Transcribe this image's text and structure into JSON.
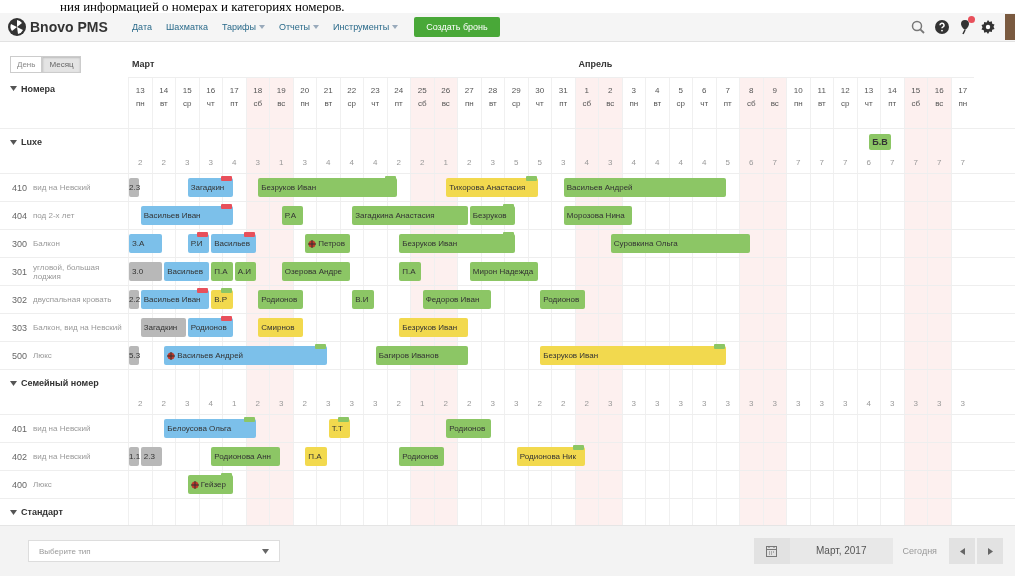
{
  "document_text": "ния информацией о номерах и категориях номеров.",
  "app": {
    "logo": "Bnovo PMS"
  },
  "nav": [
    {
      "label": "Дата",
      "dropdown": false
    },
    {
      "label": "Шахматка",
      "dropdown": false
    },
    {
      "label": "Тарифы",
      "dropdown": true
    },
    {
      "label": "Отчеты",
      "dropdown": true
    },
    {
      "label": "Инструменты",
      "dropdown": true
    }
  ],
  "create_button": "Создать бронь",
  "notifications": {
    "unread": true
  },
  "view_toggle": [
    {
      "label": "День",
      "selected": false
    },
    {
      "label": "Месяц",
      "selected": true
    }
  ],
  "rooms_header": {
    "label": "Номера",
    "expanded": true
  },
  "months": [
    {
      "name": "Март",
      "days": [
        {
          "num": "13",
          "wd": "пн",
          "weekend": false
        },
        {
          "num": "14",
          "wd": "вт",
          "weekend": false
        },
        {
          "num": "15",
          "wd": "ср",
          "weekend": false
        },
        {
          "num": "16",
          "wd": "чт",
          "weekend": false
        },
        {
          "num": "17",
          "wd": "пт",
          "weekend": false
        },
        {
          "num": "18",
          "wd": "сб",
          "weekend": true
        },
        {
          "num": "19",
          "wd": "вс",
          "weekend": true
        },
        {
          "num": "20",
          "wd": "пн",
          "weekend": false
        },
        {
          "num": "21",
          "wd": "вт",
          "weekend": false
        },
        {
          "num": "22",
          "wd": "ср",
          "weekend": false
        },
        {
          "num": "23",
          "wd": "чт",
          "weekend": false
        },
        {
          "num": "24",
          "wd": "пт",
          "weekend": false
        },
        {
          "num": "25",
          "wd": "сб",
          "weekend": true
        },
        {
          "num": "26",
          "wd": "вс",
          "weekend": true
        },
        {
          "num": "27",
          "wd": "пн",
          "weekend": false
        },
        {
          "num": "28",
          "wd": "вт",
          "weekend": false
        },
        {
          "num": "29",
          "wd": "ср",
          "weekend": false
        },
        {
          "num": "30",
          "wd": "чт",
          "weekend": false
        },
        {
          "num": "31",
          "wd": "пт",
          "weekend": false
        }
      ]
    },
    {
      "name": "Апрель",
      "days": [
        {
          "num": "1",
          "wd": "сб",
          "weekend": true
        },
        {
          "num": "2",
          "wd": "вс",
          "weekend": true
        },
        {
          "num": "3",
          "wd": "пн",
          "weekend": false
        },
        {
          "num": "4",
          "wd": "вт",
          "weekend": false
        },
        {
          "num": "5",
          "wd": "ср",
          "weekend": false
        },
        {
          "num": "6",
          "wd": "чт",
          "weekend": false
        },
        {
          "num": "7",
          "wd": "пт",
          "weekend": false
        },
        {
          "num": "8",
          "wd": "сб",
          "weekend": true
        },
        {
          "num": "9",
          "wd": "вс",
          "weekend": true
        },
        {
          "num": "10",
          "wd": "пн",
          "weekend": false
        },
        {
          "num": "11",
          "wd": "вт",
          "weekend": false
        },
        {
          "num": "12",
          "wd": "ср",
          "weekend": false
        },
        {
          "num": "13",
          "wd": "чт",
          "weekend": false
        },
        {
          "num": "14",
          "wd": "пт",
          "weekend": false
        },
        {
          "num": "15",
          "wd": "сб",
          "weekend": true
        },
        {
          "num": "16",
          "wd": "вс",
          "weekend": true
        },
        {
          "num": "17",
          "wd": "пн",
          "weekend": false
        }
      ]
    }
  ],
  "categories": [
    {
      "name": "Luxe",
      "expanded": true,
      "days": [
        {
          "free": "2"
        },
        {
          "free": "2"
        },
        {
          "free": "3"
        },
        {
          "free": "3"
        },
        {
          "free": "4"
        },
        {
          "free": "3"
        },
        {
          "free": "1"
        },
        {
          "free": "3"
        },
        {
          "free": "4"
        },
        {
          "free": "4"
        },
        {
          "free": "4"
        },
        {
          "free": "2"
        },
        {
          "free": "2"
        },
        {
          "free": "1"
        },
        {
          "free": "2"
        },
        {
          "free": "3"
        },
        {
          "free": "5"
        },
        {
          "free": "5"
        },
        {
          "free": "3"
        },
        {
          "free": "4"
        },
        {
          "free": "3"
        },
        {
          "free": "4"
        },
        {
          "free": "4"
        },
        {
          "free": "4"
        },
        {
          "free": "4"
        },
        {
          "free": "5"
        },
        {
          "free": "6"
        },
        {
          "free": "7"
        },
        {
          "free": "7"
        },
        {
          "free": "7"
        },
        {
          "free": "7"
        },
        {
          "free": "6",
          "booking": {
            "guest": "Б.В",
            "color": "#8cc665"
          }
        },
        {
          "free": "7"
        },
        {
          "free": "7"
        },
        {
          "free": "7"
        },
        {
          "free": "7"
        }
      ],
      "rooms": [
        {
          "number": "410",
          "description": "вид на Невский",
          "before": {
            "guest": "2.3",
            "color": "#b8b8b8"
          },
          "nights": [
            {
              "kind": "free"
            },
            {
              "kind": "free"
            },
            {
              "kind": "start",
              "guest": "Загадкин",
              "color": "#7cc0ea",
              "flag": {
                "color": "#e8505b"
              }
            },
            {
              "kind": "stay"
            },
            {
              "kind": "free"
            },
            {
              "kind": "start",
              "guest": "Безруков Иван",
              "color": "#8cc665",
              "flag": {
                "color": "#8cc665"
              }
            },
            {
              "kind": "stay"
            },
            {
              "kind": "stay"
            },
            {
              "kind": "stay"
            },
            {
              "kind": "stay"
            },
            {
              "kind": "stay"
            },
            {
              "kind": "free"
            },
            {
              "kind": "free"
            },
            {
              "kind": "start",
              "guest": "Тихорова Анастасия",
              "color": "#f2d94e",
              "flag": {
                "color": "#8cc665"
              }
            },
            {
              "kind": "stay"
            },
            {
              "kind": "stay"
            },
            {
              "kind": "stay"
            },
            {
              "kind": "free"
            },
            {
              "kind": "start",
              "guest": "Васильев Андрей",
              "color": "#8cc665"
            },
            {
              "kind": "stay"
            },
            {
              "kind": "stay"
            },
            {
              "kind": "stay"
            },
            {
              "kind": "stay"
            },
            {
              "kind": "stay"
            },
            {
              "kind": "stay"
            },
            {
              "kind": "free"
            },
            {
              "kind": "free"
            },
            {
              "kind": "free"
            },
            {
              "kind": "free"
            },
            {
              "kind": "free"
            },
            {
              "kind": "free"
            },
            {
              "kind": "free"
            },
            {
              "kind": "free"
            },
            {
              "kind": "free"
            },
            {
              "kind": "free"
            },
            {
              "kind": "free"
            }
          ]
        },
        {
          "number": "404",
          "description": "под 2-х лет",
          "nights": [
            {
              "kind": "start",
              "guest": "Васильев Иван",
              "color": "#7cc0ea",
              "flag": {
                "color": "#e8505b"
              }
            },
            {
              "kind": "stay"
            },
            {
              "kind": "stay"
            },
            {
              "kind": "stay"
            },
            {
              "kind": "free"
            },
            {
              "kind": "free"
            },
            {
              "kind": "start",
              "guest": "Р.А",
              "color": "#8cc665"
            },
            {
              "kind": "free"
            },
            {
              "kind": "free"
            },
            {
              "kind": "start",
              "guest": "Загадкина Анастасия",
              "color": "#8cc665"
            },
            {
              "kind": "stay"
            },
            {
              "kind": "stay"
            },
            {
              "kind": "stay"
            },
            {
              "kind": "stay"
            },
            {
              "kind": "start",
              "guest": "Безруков",
              "color": "#8cc665",
              "flag": {
                "color": "#8cc665"
              }
            },
            {
              "kind": "stay"
            },
            {
              "kind": "free"
            },
            {
              "kind": "free"
            },
            {
              "kind": "start",
              "guest": "Морозова Нина",
              "color": "#8cc665"
            },
            {
              "kind": "stay"
            },
            {
              "kind": "stay"
            },
            {
              "kind": "free"
            },
            {
              "kind": "free"
            },
            {
              "kind": "free"
            },
            {
              "kind": "free"
            },
            {
              "kind": "free"
            },
            {
              "kind": "free"
            },
            {
              "kind": "free"
            },
            {
              "kind": "free"
            },
            {
              "kind": "free"
            },
            {
              "kind": "free"
            },
            {
              "kind": "free"
            },
            {
              "kind": "free"
            },
            {
              "kind": "free"
            },
            {
              "kind": "free"
            },
            {
              "kind": "free"
            }
          ]
        },
        {
          "number": "300",
          "description": "Балкон",
          "before": {
            "guest": "З.А",
            "color": "#7cc0ea"
          },
          "nights": [
            {
              "kind": "stay"
            },
            {
              "kind": "free"
            },
            {
              "kind": "start",
              "guest": "Р.И",
              "color": "#7cc0ea",
              "flag": {
                "color": "#e8505b"
              }
            },
            {
              "kind": "start",
              "guest": "Васильев",
              "color": "#7cc0ea",
              "flag": {
                "color": "#e8505b"
              }
            },
            {
              "kind": "stay"
            },
            {
              "kind": "free"
            },
            {
              "kind": "free"
            },
            {
              "kind": "start",
              "guest": "Петров",
              "color": "#8cc665",
              "marker": true
            },
            {
              "kind": "stay"
            },
            {
              "kind": "free"
            },
            {
              "kind": "free"
            },
            {
              "kind": "start",
              "guest": "Безруков Иван",
              "color": "#8cc665",
              "flag": {
                "color": "#8cc665"
              }
            },
            {
              "kind": "stay"
            },
            {
              "kind": "stay"
            },
            {
              "kind": "stay"
            },
            {
              "kind": "stay"
            },
            {
              "kind": "free"
            },
            {
              "kind": "free"
            },
            {
              "kind": "free"
            },
            {
              "kind": "free"
            },
            {
              "kind": "start",
              "guest": "Суровкина Ольга",
              "color": "#8cc665"
            },
            {
              "kind": "stay"
            },
            {
              "kind": "stay"
            },
            {
              "kind": "stay"
            },
            {
              "kind": "stay"
            },
            {
              "kind": "stay"
            },
            {
              "kind": "free"
            },
            {
              "kind": "free"
            },
            {
              "kind": "free"
            },
            {
              "kind": "free"
            },
            {
              "kind": "free"
            },
            {
              "kind": "free"
            },
            {
              "kind": "free"
            },
            {
              "kind": "free"
            },
            {
              "kind": "free"
            },
            {
              "kind": "free"
            }
          ]
        },
        {
          "number": "301",
          "description": "угловой, большая лоджия",
          "before": {
            "guest": "3.0",
            "color": "#b8b8b8"
          },
          "nights": [
            {
              "kind": "stay"
            },
            {
              "kind": "start",
              "guest": "Васильев",
              "color": "#7cc0ea"
            },
            {
              "kind": "stay"
            },
            {
              "kind": "start",
              "guest": "П.А",
              "color": "#8cc665"
            },
            {
              "kind": "start",
              "guest": "А.И",
              "color": "#8cc665"
            },
            {
              "kind": "free"
            },
            {
              "kind": "start",
              "guest": "Озерова Андре",
              "color": "#8cc665"
            },
            {
              "kind": "stay"
            },
            {
              "kind": "stay"
            },
            {
              "kind": "free"
            },
            {
              "kind": "free"
            },
            {
              "kind": "start",
              "guest": "П.А",
              "color": "#8cc665"
            },
            {
              "kind": "free"
            },
            {
              "kind": "free"
            },
            {
              "kind": "start",
              "guest": "Мирон Надежда",
              "color": "#8cc665"
            },
            {
              "kind": "stay"
            },
            {
              "kind": "stay"
            },
            {
              "kind": "free"
            },
            {
              "kind": "free"
            },
            {
              "kind": "free"
            },
            {
              "kind": "free"
            },
            {
              "kind": "free"
            },
            {
              "kind": "free"
            },
            {
              "kind": "free"
            },
            {
              "kind": "free"
            },
            {
              "kind": "free"
            },
            {
              "kind": "free"
            },
            {
              "kind": "free"
            },
            {
              "kind": "free"
            },
            {
              "kind": "free"
            },
            {
              "kind": "free"
            },
            {
              "kind": "free"
            },
            {
              "kind": "free"
            },
            {
              "kind": "free"
            },
            {
              "kind": "free"
            },
            {
              "kind": "free"
            }
          ]
        },
        {
          "number": "302",
          "description": "двуспальная кровать",
          "before": {
            "guest": "2.2",
            "color": "#b8b8b8"
          },
          "nights": [
            {
              "kind": "start",
              "guest": "Васильев Иван",
              "color": "#7cc0ea",
              "flag": {
                "color": "#e8505b"
              }
            },
            {
              "kind": "stay"
            },
            {
              "kind": "stay"
            },
            {
              "kind": "start",
              "guest": "В.Р",
              "color": "#f2d94e",
              "flag": {
                "color": "#8cc665"
              }
            },
            {
              "kind": "free"
            },
            {
              "kind": "start",
              "guest": "Родионов",
              "color": "#8cc665"
            },
            {
              "kind": "stay"
            },
            {
              "kind": "free"
            },
            {
              "kind": "free"
            },
            {
              "kind": "start",
              "guest": "В.И",
              "color": "#8cc665"
            },
            {
              "kind": "free"
            },
            {
              "kind": "free"
            },
            {
              "kind": "start",
              "guest": "Федоров Иван",
              "color": "#8cc665"
            },
            {
              "kind": "stay"
            },
            {
              "kind": "stay"
            },
            {
              "kind": "free"
            },
            {
              "kind": "free"
            },
            {
              "kind": "start",
              "guest": "Родионов",
              "color": "#8cc665"
            },
            {
              "kind": "stay"
            },
            {
              "kind": "free"
            },
            {
              "kind": "free"
            },
            {
              "kind": "free"
            },
            {
              "kind": "free"
            },
            {
              "kind": "free"
            },
            {
              "kind": "free"
            },
            {
              "kind": "free"
            },
            {
              "kind": "free"
            },
            {
              "kind": "free"
            },
            {
              "kind": "free"
            },
            {
              "kind": "free"
            },
            {
              "kind": "free"
            },
            {
              "kind": "free"
            },
            {
              "kind": "free"
            },
            {
              "kind": "free"
            },
            {
              "kind": "free"
            },
            {
              "kind": "free"
            }
          ]
        },
        {
          "number": "303",
          "description": "Балкон, вид на Невский",
          "nights": [
            {
              "kind": "start",
              "guest": "Загадкин",
              "color": "#b8b8b8"
            },
            {
              "kind": "stay"
            },
            {
              "kind": "start",
              "guest": "Родионов",
              "color": "#7cc0ea",
              "flag": {
                "color": "#e8505b"
              }
            },
            {
              "kind": "stay"
            },
            {
              "kind": "free"
            },
            {
              "kind": "start",
              "guest": "Смирнов",
              "color": "#f2d94e"
            },
            {
              "kind": "stay"
            },
            {
              "kind": "free"
            },
            {
              "kind": "free"
            },
            {
              "kind": "free"
            },
            {
              "kind": "free"
            },
            {
              "kind": "start",
              "guest": "Безруков Иван",
              "color": "#f2d94e"
            },
            {
              "kind": "stay"
            },
            {
              "kind": "stay"
            },
            {
              "kind": "free"
            },
            {
              "kind": "free"
            },
            {
              "kind": "free"
            },
            {
              "kind": "free"
            },
            {
              "kind": "free"
            },
            {
              "kind": "free"
            },
            {
              "kind": "free"
            },
            {
              "kind": "free"
            },
            {
              "kind": "free"
            },
            {
              "kind": "free"
            },
            {
              "kind": "free"
            },
            {
              "kind": "free"
            },
            {
              "kind": "free"
            },
            {
              "kind": "free"
            },
            {
              "kind": "free"
            },
            {
              "kind": "free"
            },
            {
              "kind": "free"
            },
            {
              "kind": "free"
            },
            {
              "kind": "free"
            },
            {
              "kind": "free"
            },
            {
              "kind": "free"
            },
            {
              "kind": "free"
            }
          ]
        },
        {
          "number": "500",
          "description": "Люкс",
          "before": {
            "guest": "5.3",
            "color": "#b8b8b8"
          },
          "nights": [
            {
              "kind": "free"
            },
            {
              "kind": "start",
              "guest": "Васильев Андрей",
              "color": "#7cc0ea",
              "flag": {
                "color": "#8cc665"
              },
              "marker": true
            },
            {
              "kind": "stay"
            },
            {
              "kind": "stay"
            },
            {
              "kind": "stay"
            },
            {
              "kind": "stay"
            },
            {
              "kind": "stay"
            },
            {
              "kind": "stay"
            },
            {
              "kind": "free"
            },
            {
              "kind": "free"
            },
            {
              "kind": "start",
              "guest": "Багиров Иванов",
              "color": "#8cc665"
            },
            {
              "kind": "stay"
            },
            {
              "kind": "stay"
            },
            {
              "kind": "stay"
            },
            {
              "kind": "free"
            },
            {
              "kind": "free"
            },
            {
              "kind": "free"
            },
            {
              "kind": "start",
              "guest": "Безруков Иван",
              "color": "#f2d94e",
              "flag": {
                "color": "#8cc665"
              }
            },
            {
              "kind": "stay"
            },
            {
              "kind": "stay"
            },
            {
              "kind": "stay"
            },
            {
              "kind": "stay"
            },
            {
              "kind": "stay"
            },
            {
              "kind": "stay"
            },
            {
              "kind": "stay"
            },
            {
              "kind": "free"
            },
            {
              "kind": "free"
            },
            {
              "kind": "free"
            },
            {
              "kind": "free"
            },
            {
              "kind": "free"
            },
            {
              "kind": "free"
            },
            {
              "kind": "free"
            },
            {
              "kind": "free"
            },
            {
              "kind": "free"
            },
            {
              "kind": "free"
            },
            {
              "kind": "free"
            }
          ]
        }
      ]
    },
    {
      "name": "Семейный номер",
      "expanded": true,
      "days": [
        {
          "free": "2"
        },
        {
          "free": "2"
        },
        {
          "free": "3"
        },
        {
          "free": "4"
        },
        {
          "free": "1"
        },
        {
          "free": "2"
        },
        {
          "free": "3"
        },
        {
          "free": "2"
        },
        {
          "free": "3"
        },
        {
          "free": "3"
        },
        {
          "free": "3"
        },
        {
          "free": "2"
        },
        {
          "free": "1"
        },
        {
          "free": "2"
        },
        {
          "free": "2"
        },
        {
          "free": "3"
        },
        {
          "free": "3"
        },
        {
          "free": "2"
        },
        {
          "free": "2"
        },
        {
          "free": "2"
        },
        {
          "free": "3"
        },
        {
          "free": "3"
        },
        {
          "free": "3"
        },
        {
          "free": "3"
        },
        {
          "free": "3"
        },
        {
          "free": "3"
        },
        {
          "free": "3"
        },
        {
          "free": "3"
        },
        {
          "free": "3"
        },
        {
          "free": "3"
        },
        {
          "free": "3"
        },
        {
          "free": "4"
        },
        {
          "free": "3"
        },
        {
          "free": "3"
        },
        {
          "free": "3"
        },
        {
          "free": "3"
        }
      ],
      "rooms": [
        {
          "number": "401",
          "description": "вид на Невский",
          "nights": [
            {
              "kind": "free"
            },
            {
              "kind": "start",
              "guest": "Белоусова Ольга",
              "color": "#7cc0ea",
              "flag": {
                "color": "#8cc665"
              }
            },
            {
              "kind": "stay"
            },
            {
              "kind": "stay"
            },
            {
              "kind": "stay"
            },
            {
              "kind": "free"
            },
            {
              "kind": "free"
            },
            {
              "kind": "free"
            },
            {
              "kind": "start",
              "guest": "Т.Т",
              "color": "#f2d94e",
              "flag": {
                "color": "#8cc665"
              }
            },
            {
              "kind": "free"
            },
            {
              "kind": "free"
            },
            {
              "kind": "free"
            },
            {
              "kind": "free"
            },
            {
              "kind": "start",
              "guest": "Родионов",
              "color": "#8cc665"
            },
            {
              "kind": "stay"
            },
            {
              "kind": "free"
            },
            {
              "kind": "free"
            },
            {
              "kind": "free"
            },
            {
              "kind": "free"
            },
            {
              "kind": "free"
            },
            {
              "kind": "free"
            },
            {
              "kind": "free"
            },
            {
              "kind": "free"
            },
            {
              "kind": "free"
            },
            {
              "kind": "free"
            },
            {
              "kind": "free"
            },
            {
              "kind": "free"
            },
            {
              "kind": "free"
            },
            {
              "kind": "free"
            },
            {
              "kind": "free"
            },
            {
              "kind": "free"
            },
            {
              "kind": "free"
            },
            {
              "kind": "free"
            },
            {
              "kind": "free"
            },
            {
              "kind": "free"
            },
            {
              "kind": "free"
            }
          ]
        },
        {
          "number": "402",
          "description": "вид на Невский",
          "before": {
            "guest": "1.1",
            "color": "#b8b8b8"
          },
          "nights": [
            {
              "kind": "start",
              "guest": "2.3",
              "color": "#b8b8b8"
            },
            {
              "kind": "free"
            },
            {
              "kind": "free"
            },
            {
              "kind": "start",
              "guest": "Родионова Анн",
              "color": "#8cc665"
            },
            {
              "kind": "stay"
            },
            {
              "kind": "stay"
            },
            {
              "kind": "free"
            },
            {
              "kind": "start",
              "guest": "П.А",
              "color": "#f2d94e"
            },
            {
              "kind": "free"
            },
            {
              "kind": "free"
            },
            {
              "kind": "free"
            },
            {
              "kind": "start",
              "guest": "Родионов",
              "color": "#8cc665"
            },
            {
              "kind": "stay"
            },
            {
              "kind": "free"
            },
            {
              "kind": "free"
            },
            {
              "kind": "free"
            },
            {
              "kind": "start",
              "guest": "Родионова Ник",
              "color": "#f2d94e",
              "flag": {
                "color": "#8cc665"
              }
            },
            {
              "kind": "stay"
            },
            {
              "kind": "stay"
            },
            {
              "kind": "free"
            },
            {
              "kind": "free"
            },
            {
              "kind": "free"
            },
            {
              "kind": "free"
            },
            {
              "kind": "free"
            },
            {
              "kind": "free"
            },
            {
              "kind": "free"
            },
            {
              "kind": "free"
            },
            {
              "kind": "free"
            },
            {
              "kind": "free"
            },
            {
              "kind": "free"
            },
            {
              "kind": "free"
            },
            {
              "kind": "free"
            },
            {
              "kind": "free"
            },
            {
              "kind": "free"
            },
            {
              "kind": "free"
            },
            {
              "kind": "free"
            }
          ]
        },
        {
          "number": "400",
          "description": "Люкс",
          "nights": [
            {
              "kind": "free"
            },
            {
              "kind": "free"
            },
            {
              "kind": "start",
              "guest": "Гейзер",
              "color": "#8cc665",
              "flag": {
                "color": "#8cc665"
              },
              "marker": true
            },
            {
              "kind": "stay"
            },
            {
              "kind": "free"
            },
            {
              "kind": "free"
            },
            {
              "kind": "free"
            },
            {
              "kind": "free"
            },
            {
              "kind": "free"
            },
            {
              "kind": "free"
            },
            {
              "kind": "free"
            },
            {
              "kind": "free"
            },
            {
              "kind": "free"
            },
            {
              "kind": "free"
            },
            {
              "kind": "free"
            },
            {
              "kind": "free"
            },
            {
              "kind": "free"
            },
            {
              "kind": "free"
            },
            {
              "kind": "free"
            },
            {
              "kind": "free"
            },
            {
              "kind": "free"
            },
            {
              "kind": "free"
            },
            {
              "kind": "free"
            },
            {
              "kind": "free"
            },
            {
              "kind": "free"
            },
            {
              "kind": "free"
            },
            {
              "kind": "free"
            },
            {
              "kind": "free"
            },
            {
              "kind": "free"
            },
            {
              "kind": "free"
            },
            {
              "kind": "free"
            },
            {
              "kind": "free"
            },
            {
              "kind": "free"
            },
            {
              "kind": "free"
            },
            {
              "kind": "free"
            },
            {
              "kind": "free"
            }
          ]
        }
      ]
    },
    {
      "name": "Стандарт",
      "expanded": true
    }
  ],
  "footer": {
    "type_select": {
      "placeholder": "Выберите тип"
    },
    "period": "Март, 2017",
    "today_button": "Сегодня"
  }
}
